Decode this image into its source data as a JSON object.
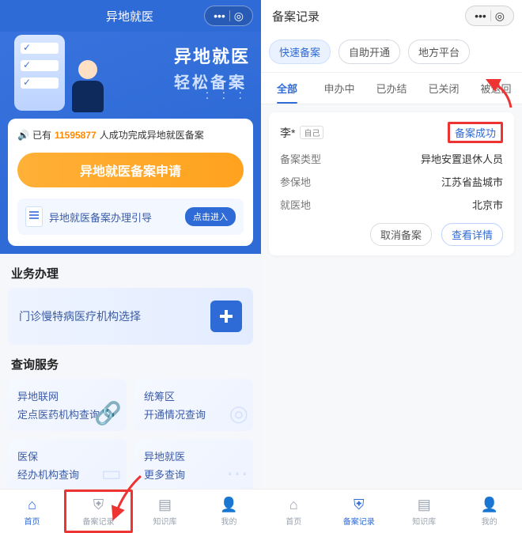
{
  "left": {
    "header_title": "异地就医",
    "hero_line1": "异地就医",
    "hero_line2": "轻松备案",
    "count_prefix": "已有",
    "count_number": "11595877",
    "count_suffix": "人成功完成异地就医备案",
    "apply_button": "异地就医备案申请",
    "guide_text": "异地就医备案办理引导",
    "guide_enter": "点击进入",
    "section_biz": "业务办理",
    "biz_card": "门诊慢特病医疗机构选择",
    "section_query": "查询服务",
    "q1a": "异地联网",
    "q1b": "定点医药机构查询",
    "q2a": "统筹区",
    "q2b": "开通情况查询",
    "q3a": "医保",
    "q3b": "经办机构查询",
    "q4a": "异地就医",
    "q4b": "更多查询",
    "tabs": [
      "首页",
      "备案记录",
      "知识库",
      "我的"
    ]
  },
  "right": {
    "header_title": "备案记录",
    "pills": [
      "快速备案",
      "自助开通",
      "地方平台"
    ],
    "subtabs": [
      "全部",
      "申办中",
      "已办结",
      "已关闭",
      "被退回"
    ],
    "record": {
      "name": "李*",
      "self_tag": "自己",
      "status": "备案成功",
      "rows": [
        {
          "k": "备案类型",
          "v": "异地安置退休人员"
        },
        {
          "k": "参保地",
          "v": "江苏省盐城市"
        },
        {
          "k": "就医地",
          "v": "北京市"
        }
      ],
      "cancel": "取消备案",
      "detail": "查看详情"
    },
    "tabs": [
      "首页",
      "备案记录",
      "知识库",
      "我的"
    ]
  }
}
